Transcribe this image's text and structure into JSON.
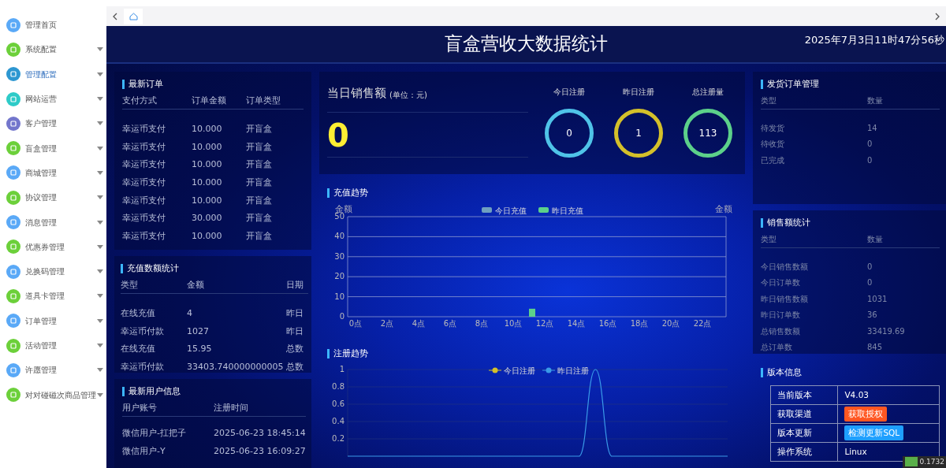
{
  "sidebar": {
    "items": [
      {
        "label": "管理首页",
        "color": "#5aa9f7",
        "expandable": false,
        "selected": false
      },
      {
        "label": "系统配置",
        "color": "#6cd03a",
        "expandable": true,
        "selected": false
      },
      {
        "label": "管理配置",
        "color": "#2d97d1",
        "expandable": true,
        "selected": true
      },
      {
        "label": "网站运营",
        "color": "#2ecbc8",
        "expandable": true,
        "selected": false
      },
      {
        "label": "客户管理",
        "color": "#7376cc",
        "expandable": true,
        "selected": false
      },
      {
        "label": "盲盒管理",
        "color": "#6cd03a",
        "expandable": true,
        "selected": false
      },
      {
        "label": "商城管理",
        "color": "#5aa9f7",
        "expandable": true,
        "selected": false
      },
      {
        "label": "协议管理",
        "color": "#6cd03a",
        "expandable": true,
        "selected": false
      },
      {
        "label": "消息管理",
        "color": "#5aa9f7",
        "expandable": true,
        "selected": false
      },
      {
        "label": "优惠券管理",
        "color": "#6cd03a",
        "expandable": true,
        "selected": false
      },
      {
        "label": "兑换码管理",
        "color": "#5aa9f7",
        "expandable": true,
        "selected": false
      },
      {
        "label": "道具卡管理",
        "color": "#6cd03a",
        "expandable": true,
        "selected": false
      },
      {
        "label": "订单管理",
        "color": "#5aa9f7",
        "expandable": true,
        "selected": false
      },
      {
        "label": "活动管理",
        "color": "#6cd03a",
        "expandable": true,
        "selected": false
      },
      {
        "label": "许愿管理",
        "color": "#5aa9f7",
        "expandable": true,
        "selected": false
      },
      {
        "label": "对对碰磁次商品管理",
        "color": "#6cd03a",
        "expandable": true,
        "selected": false
      }
    ]
  },
  "tabbar": {
    "tabs": [
      {
        "kind": "home",
        "selected": true
      }
    ]
  },
  "header": {
    "title": "盲盒营收大数据统计",
    "datetime": "2025年7月3日11时47分56秒"
  },
  "latest_orders": {
    "title": "最新订单",
    "columns": [
      "支付方式",
      "订单金额",
      "订单类型"
    ],
    "rows": [
      [
        "幸运币支付",
        "10.000",
        "开盲盒"
      ],
      [
        "幸运币支付",
        "10.000",
        "开盲盒"
      ],
      [
        "幸运币支付",
        "10.000",
        "开盲盒"
      ],
      [
        "幸运币支付",
        "10.000",
        "开盲盒"
      ],
      [
        "幸运币支付",
        "10.000",
        "开盲盒"
      ],
      [
        "幸运币支付",
        "30.000",
        "开盲盒"
      ],
      [
        "幸运币支付",
        "10.000",
        "开盲盒"
      ]
    ]
  },
  "recharge_stats": {
    "title": "充值数额统计",
    "columns": [
      "类型",
      "金额",
      "日期"
    ],
    "rows": [
      [
        "在线充值",
        "4",
        "昨日"
      ],
      [
        "幸运币付款",
        "1027",
        "昨日"
      ],
      [
        "在线充值",
        "15.95",
        "总数"
      ],
      [
        "幸运币付款",
        "33403.740000000005",
        "总数"
      ]
    ]
  },
  "latest_users": {
    "title": "最新用户信息",
    "columns": [
      "用户账号",
      "注册时间"
    ],
    "rows": [
      [
        "微信用户-扛把子",
        "2025-06-23 18:45:14"
      ],
      [
        "微信用户-Y",
        "2025-06-23 16:09:27"
      ]
    ]
  },
  "daily_sales": {
    "title": "当日销售额",
    "unit": "(单位：元)",
    "value": "0"
  },
  "registrations": [
    {
      "label": "今日注册",
      "value": "0",
      "color": "#4fc3e8"
    },
    {
      "label": "昨日注册",
      "value": "1",
      "color": "#d4c02a"
    },
    {
      "label": "总注册量",
      "value": "113",
      "color": "#5cd08a"
    }
  ],
  "recharge_trend": {
    "title": "充值趋势",
    "chart_data": {
      "type": "bar",
      "ylabel": "金额",
      "x": [
        0,
        1,
        2,
        3,
        4,
        5,
        6,
        7,
        8,
        9,
        10,
        11,
        12,
        13,
        14,
        15,
        16,
        17,
        18,
        19,
        20,
        21,
        22,
        23
      ],
      "grid": true,
      "legend": true,
      "xlim": [
        -0.5,
        23.5
      ],
      "annotations": [
        "金额"
      ],
      "xticks": [
        {
          "value": 0,
          "label": "0点"
        },
        {
          "value": 2,
          "label": "2点"
        },
        {
          "value": 4,
          "label": "4点"
        },
        {
          "value": 6,
          "label": "6点"
        },
        {
          "value": 8,
          "label": "8点"
        },
        {
          "value": 10,
          "label": "10点"
        },
        {
          "value": 12,
          "label": "12点"
        },
        {
          "value": 14,
          "label": "14点"
        },
        {
          "value": 16,
          "label": "16点"
        },
        {
          "value": 18,
          "label": "18点"
        },
        {
          "value": 20,
          "label": "20点"
        },
        {
          "value": 22,
          "label": "22点"
        }
      ],
      "series": [
        {
          "name": "今日充值",
          "color": "#6fa0c0",
          "values": [
            0,
            0,
            0,
            0,
            0,
            0,
            0,
            0,
            0,
            0,
            0,
            0,
            0,
            0,
            0,
            0,
            0,
            0,
            0,
            0,
            0,
            0,
            0,
            0
          ]
        },
        {
          "name": "昨日充值",
          "color": "#5cd08a",
          "values": [
            0,
            0,
            0,
            0,
            0,
            0,
            0,
            0,
            0,
            0,
            0,
            4,
            0,
            0,
            0,
            0,
            0,
            0,
            0,
            0,
            0,
            0,
            0,
            0
          ]
        }
      ],
      "ylim": [
        0,
        50
      ],
      "yticks": [
        0,
        10,
        20,
        30,
        40,
        50
      ]
    }
  },
  "register_trend": {
    "title": "注册趋势",
    "chart_data": {
      "type": "line",
      "grid": true,
      "legend": true,
      "series": [
        {
          "name": "今日注册",
          "color": "#d4c02a",
          "values": [
            null,
            null,
            null,
            null,
            null,
            null,
            null,
            null,
            null,
            null,
            null,
            null,
            null,
            null,
            null,
            null,
            null,
            null,
            null,
            null,
            null,
            null,
            null,
            null
          ]
        },
        {
          "name": "昨日注册",
          "color": "#3a9ae8",
          "values": [
            0,
            0,
            0,
            0,
            0,
            0,
            0,
            0,
            0,
            0,
            0,
            0,
            0,
            0,
            0,
            1,
            0,
            0,
            0,
            0,
            0,
            0,
            0,
            0
          ]
        }
      ],
      "ylim": [
        0,
        1
      ],
      "yticks": [
        0.2,
        0.4,
        0.6,
        0.8,
        1
      ]
    }
  },
  "shipping_orders": {
    "title": "发货订单管理",
    "columns": [
      "类型",
      "数量"
    ],
    "rows": [
      [
        "待发货",
        "14"
      ],
      [
        "待收货",
        "0"
      ],
      [
        "已完成",
        "0"
      ]
    ]
  },
  "sales_stats": {
    "title": "销售额统计",
    "columns": [
      "类型",
      "数量"
    ],
    "rows": [
      [
        "今日销售数额",
        "0"
      ],
      [
        "今日订单数",
        "0"
      ],
      [
        "昨日销售数额",
        "1031"
      ],
      [
        "昨日订单数",
        "36"
      ],
      [
        "总销售数额",
        "33419.69"
      ],
      [
        "总订单数",
        "845"
      ]
    ]
  },
  "version_info": {
    "title": "版本信息",
    "rows": [
      {
        "label": "当前版本",
        "kind": "text",
        "value": "V4.03"
      },
      {
        "label": "获取渠道",
        "kind": "button",
        "value": "获取授权",
        "color": "#ff5722"
      },
      {
        "label": "版本更新",
        "kind": "button",
        "value": "检测更新SQL",
        "color": "#1e9fff"
      },
      {
        "label": "操作系统",
        "kind": "text",
        "value": "Linux"
      }
    ]
  },
  "speed_badge": "0.1732"
}
